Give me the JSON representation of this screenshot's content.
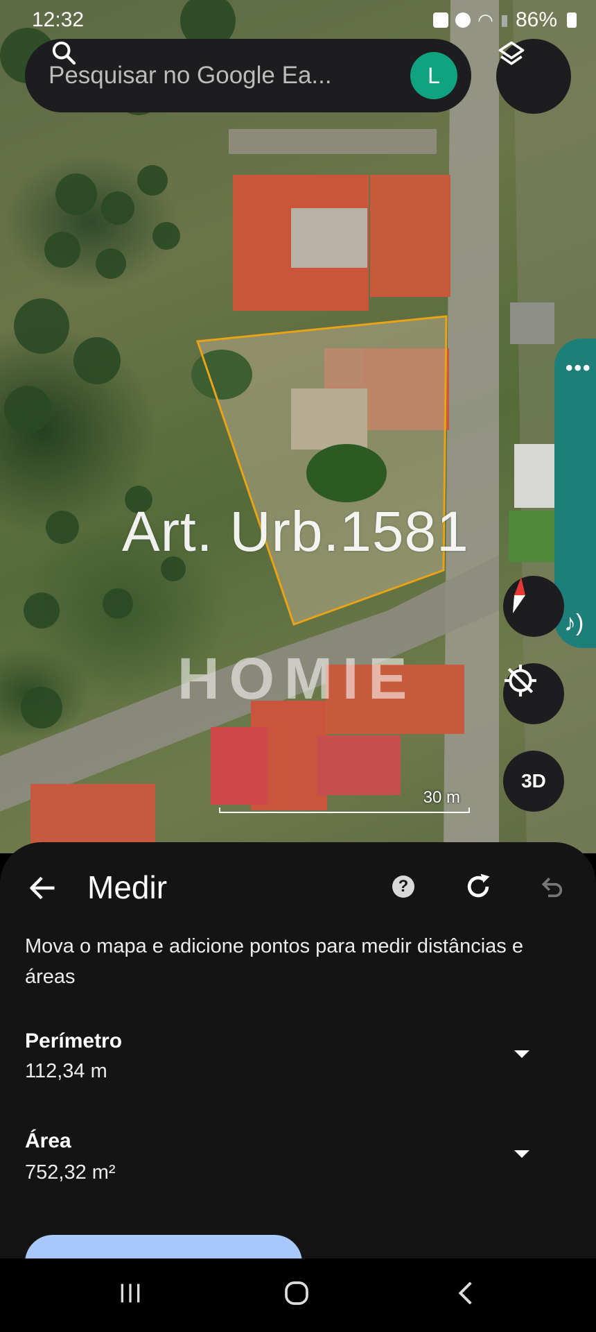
{
  "status_bar": {
    "time": "12:32",
    "battery": "86%"
  },
  "search": {
    "placeholder": "Pesquisar no Google Ea...",
    "avatar_letter": "L"
  },
  "map": {
    "overlay_label": "Art. Urb.1581",
    "watermark": "HOMIE",
    "scale_label": "30 m",
    "button_3d": "3D"
  },
  "measure": {
    "title": "Medir",
    "instructions": "Mova o mapa e adicione pontos para medir distâncias e áreas",
    "perimeter_label": "Perímetro",
    "perimeter_value": "112,34 m",
    "area_label": "Área",
    "area_value": "752,32 m²"
  },
  "colors": {
    "plot_outline": "#e8a317",
    "avatar_bg": "#10a37f",
    "side_panel": "#1e7f7a",
    "sheet_bg": "#141414"
  },
  "icons": [
    "search-icon",
    "layers-icon",
    "compass-icon",
    "locate-off-icon",
    "help-icon",
    "refresh-icon",
    "undo-icon",
    "back-arrow-icon",
    "audio-icon"
  ]
}
